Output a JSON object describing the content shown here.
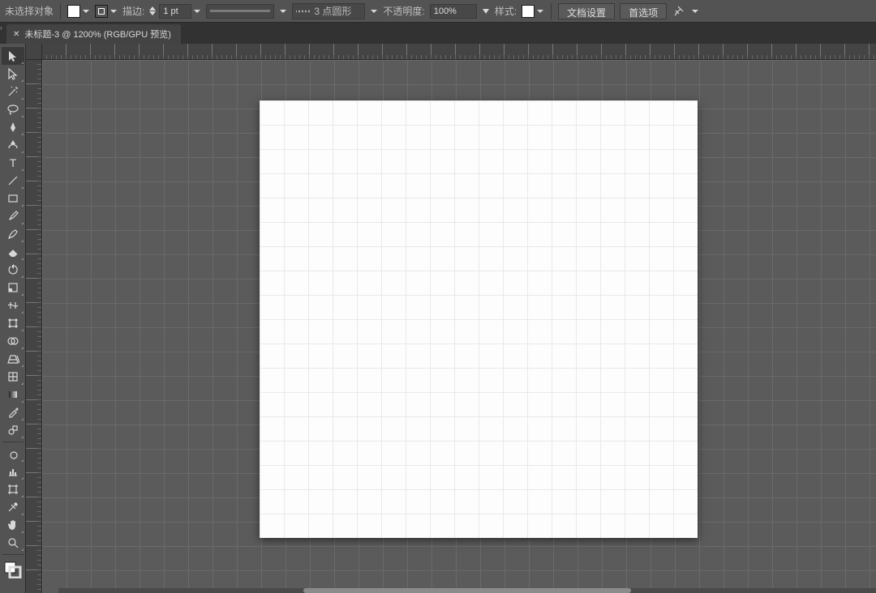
{
  "options_bar": {
    "selection_label": "未选择对象",
    "fill_color": "#ffffff",
    "stroke_color": "#000000",
    "stroke_label": "描边:",
    "stroke_weight": "1 pt",
    "stroke_sample_color": "#7a7a7a",
    "brush_preset": "3 点圆形",
    "opacity_label": "不透明度:",
    "opacity_value": "100%",
    "style_label": "样式:",
    "style_swatch": "#ffffff",
    "doc_setup_label": "文档设置",
    "prefs_label": "首选项"
  },
  "tab": {
    "title": "未标题-3 @ 1200% (RGB/GPU 预览)"
  },
  "tools": [
    {
      "name": "selection-tool",
      "icon": "cursor",
      "active": true
    },
    {
      "name": "direct-select-tool",
      "icon": "cursor-white"
    },
    {
      "name": "magic-wand-tool",
      "icon": "wand"
    },
    {
      "name": "lasso-tool",
      "icon": "lasso"
    },
    {
      "name": "pen-tool",
      "icon": "pen"
    },
    {
      "name": "curvature-tool",
      "icon": "curvature"
    },
    {
      "name": "type-tool",
      "icon": "type"
    },
    {
      "name": "line-tool",
      "icon": "line"
    },
    {
      "name": "rectangle-tool",
      "icon": "rect"
    },
    {
      "name": "paintbrush-tool",
      "icon": "brush"
    },
    {
      "name": "shaper-tool",
      "icon": "pencil-shaper"
    },
    {
      "name": "eraser-tool",
      "icon": "eraser"
    },
    {
      "name": "rotate-tool",
      "icon": "rotate"
    },
    {
      "name": "scale-tool",
      "icon": "scale"
    },
    {
      "name": "width-tool",
      "icon": "width"
    },
    {
      "name": "free-transform-tool",
      "icon": "free-transform"
    },
    {
      "name": "shape-builder-tool",
      "icon": "shape-builder"
    },
    {
      "name": "perspective-tool",
      "icon": "perspective"
    },
    {
      "name": "mesh-tool",
      "icon": "mesh"
    },
    {
      "name": "gradient-tool",
      "icon": "gradient"
    },
    {
      "name": "eyedropper-tool",
      "icon": "eyedropper"
    },
    {
      "name": "blend-tool",
      "icon": "blend"
    },
    {
      "name": "symbol-sprayer-tool",
      "icon": "spray"
    },
    {
      "name": "graph-tool",
      "icon": "graph"
    },
    {
      "name": "artboard-tool",
      "icon": "artboard"
    },
    {
      "name": "slice-tool",
      "icon": "slice"
    },
    {
      "name": "hand-tool",
      "icon": "hand"
    },
    {
      "name": "zoom-tool",
      "icon": "zoom"
    }
  ]
}
